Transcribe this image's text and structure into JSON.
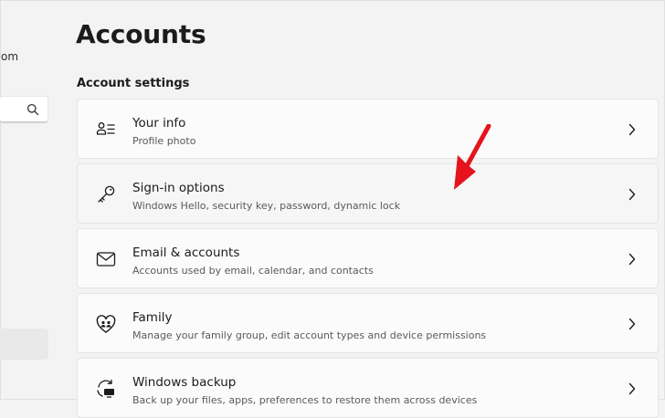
{
  "left_pane": {
    "account_snippet": "om"
  },
  "page": {
    "title": "Accounts"
  },
  "section": {
    "header": "Account settings"
  },
  "cards": [
    {
      "title": "Your info",
      "subtitle": "Profile photo",
      "icon": "person-list-icon"
    },
    {
      "title": "Sign-in options",
      "subtitle": "Windows Hello, security key, password, dynamic lock",
      "icon": "key-icon"
    },
    {
      "title": "Email & accounts",
      "subtitle": "Accounts used by email, calendar, and contacts",
      "icon": "mail-icon"
    },
    {
      "title": "Family",
      "subtitle": "Manage your family group, edit account types and device permissions",
      "icon": "family-heart-icon"
    },
    {
      "title": "Windows backup",
      "subtitle": "Back up your files, apps, preferences to restore them across devices",
      "icon": "backup-icon"
    }
  ],
  "colors": {
    "background": "#f3f3f3",
    "card": "#fbfbfb",
    "annotation_arrow": "#e5141c"
  }
}
